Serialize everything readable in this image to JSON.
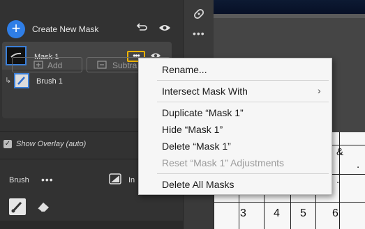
{
  "masks_panel": {
    "create_label": "Create New Mask",
    "add_icon": "plus-icon",
    "mask": {
      "name": "Mask 1",
      "more_label": "•••"
    },
    "sub_mask": {
      "name": "Brush 1"
    },
    "add_button": "Add",
    "subtract_button": "Subtra",
    "show_overlay": {
      "label": "Show Overlay (auto)",
      "checked": true,
      "check_glyph": "✓"
    }
  },
  "brush_section": {
    "label": "Brush",
    "more": "•••",
    "invert_label": "In"
  },
  "tool_strip": {
    "more": "•••"
  },
  "context_menu": {
    "items": [
      {
        "label": "Rename..."
      },
      {
        "label": "Intersect Mask With",
        "submenu": "›"
      },
      {
        "label": "Duplicate “Mask 1”"
      },
      {
        "label": "Hide “Mask 1”"
      },
      {
        "label": "Delete “Mask 1”"
      },
      {
        "label": "Reset “Mask 1” Adjustments",
        "disabled": true
      },
      {
        "label": "Delete All Masks"
      }
    ]
  },
  "document": {
    "glyphs": [
      "&",
      ".",
      "."
    ],
    "numbers": [
      "3",
      "4",
      "5",
      "6"
    ]
  },
  "colors": {
    "accent": "#2f7ee6",
    "highlight": "#f0b400",
    "panel": "#323232"
  }
}
